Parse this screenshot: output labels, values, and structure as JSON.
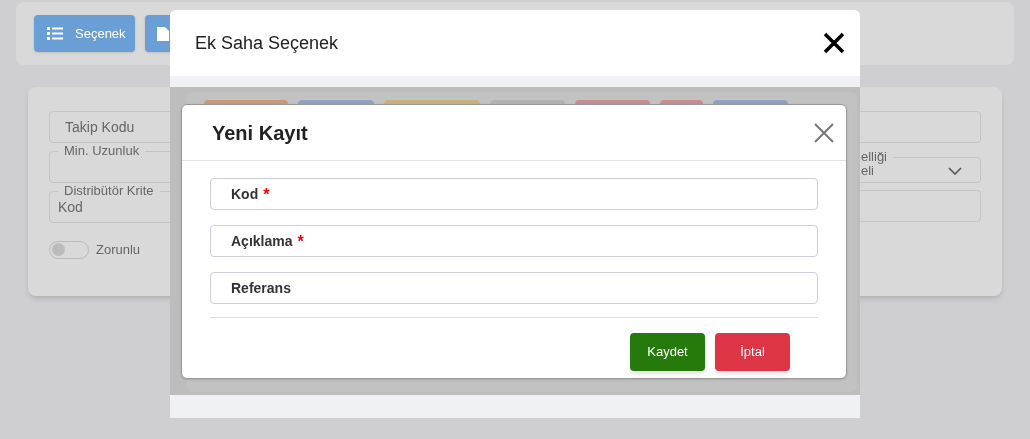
{
  "background": {
    "toolbar_buttons": [
      {
        "kind": "labeled",
        "label": "Seçenek"
      },
      {
        "kind": "icon_only"
      }
    ],
    "left_fields": [
      {
        "kind": "placeholder",
        "label": "Takip Kodu"
      },
      {
        "kind": "legend",
        "label": "Min. Uzunluk"
      },
      {
        "kind": "legend",
        "label": "Distribütör Krite",
        "value": "Kod"
      }
    ],
    "toggle": {
      "label": "Zorunlu",
      "on": false
    },
    "right_fields": [
      {
        "kind": "empty"
      },
      {
        "kind": "select",
        "label": "elliği",
        "value": "eli"
      },
      {
        "kind": "empty"
      }
    ]
  },
  "outer_modal": {
    "title": "Ek Saha Seçenek",
    "hidden_buttons": [
      {
        "color": "#c79b7a"
      },
      {
        "color": "#8fa3bf"
      },
      {
        "color": "#c8b27c"
      },
      {
        "color": "#b3b3b3"
      },
      {
        "color": "#c78d91"
      },
      {
        "color": "#c78d91"
      },
      {
        "color": "#8fa3bf"
      }
    ]
  },
  "inner_modal": {
    "title": "Yeni Kayıt",
    "required_mark": "*",
    "fields": [
      {
        "label": "Kod",
        "required": true
      },
      {
        "label": "Açıklama",
        "required": true
      },
      {
        "label": "Referans",
        "required": false
      }
    ],
    "buttons": [
      {
        "kind": "save",
        "label": "Kaydet"
      },
      {
        "kind": "cancel",
        "label": "İptal"
      }
    ]
  }
}
